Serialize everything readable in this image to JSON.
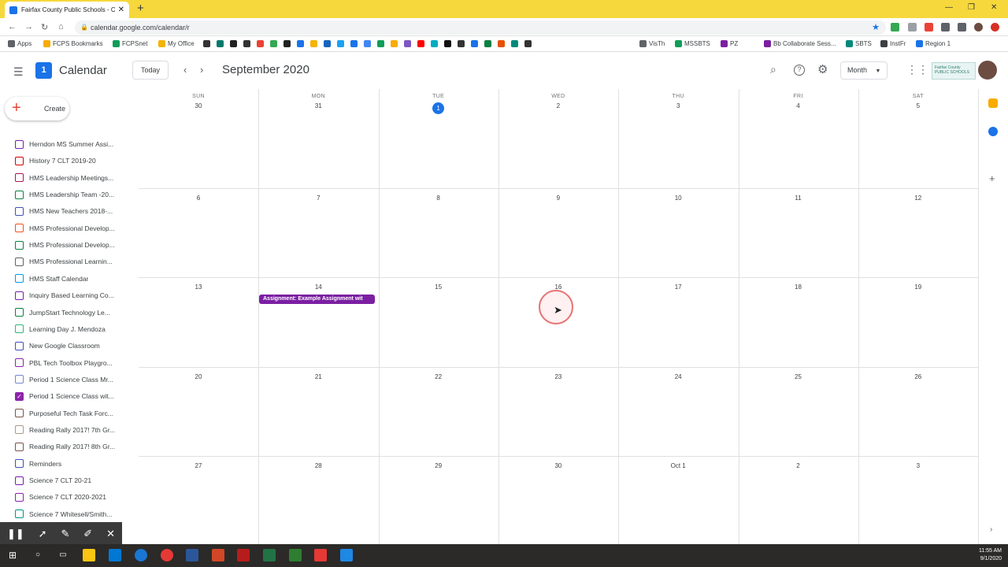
{
  "browser": {
    "tab_title": "Fairfax County Public Schools - C",
    "url": "calendar.google.com/calendar/r"
  },
  "bookmarks": [
    {
      "label": "Apps",
      "color": "#5f6368"
    },
    {
      "label": "FCPS Bookmarks",
      "color": "#f9ab00"
    },
    {
      "label": "FCPSnet",
      "color": "#0f9d58"
    },
    {
      "label": "My Office",
      "color": "#f4b400"
    },
    {
      "label": "VisTh",
      "color": "#5f6368"
    },
    {
      "label": "MSSBTS",
      "color": "#0f9d58"
    },
    {
      "label": "PZ",
      "color": "#7b1fa2"
    },
    {
      "label": "Bb Collaborate Sess...",
      "color": "#7b1fa2"
    },
    {
      "label": "SBTS",
      "color": "#00897b"
    },
    {
      "label": "InstFr",
      "color": "#3c4043"
    },
    {
      "label": "Region 1",
      "color": "#1a73e8"
    }
  ],
  "header": {
    "app_name": "Calendar",
    "logo_day": "1",
    "today_label": "Today",
    "prev_symbol": "‹",
    "next_symbol": "›",
    "month_title": "September 2020",
    "view_label": "Month",
    "org_logo_text": "Fairfax County PUBLIC SCHOOLS"
  },
  "sidebar": {
    "create_label": "Create",
    "calendars": [
      {
        "label": "Herndon MS Summer Assi...",
        "color": "#7b1fa2",
        "checked": false
      },
      {
        "label": "History 7 CLT 2019-20",
        "color": "#d50000",
        "checked": false
      },
      {
        "label": "HMS Leadership Meetings...",
        "color": "#ad1457",
        "checked": false
      },
      {
        "label": "HMS Leadership Team -20...",
        "color": "#0b8043",
        "checked": false
      },
      {
        "label": "HMS New Teachers 2018-...",
        "color": "#3f51b5",
        "checked": false
      },
      {
        "label": "HMS Professional Develop...",
        "color": "#f4511e",
        "checked": false
      },
      {
        "label": "HMS Professional Develop...",
        "color": "#0b8043",
        "checked": false
      },
      {
        "label": "HMS Professional Learnin...",
        "color": "#616161",
        "checked": false
      },
      {
        "label": "HMS Staff Calendar",
        "color": "#039be5",
        "checked": false
      },
      {
        "label": "Inquiry Based Learning Co...",
        "color": "#7b1fa2",
        "checked": false
      },
      {
        "label": "JumpStart Technology Le...",
        "color": "#0b8043",
        "checked": false
      },
      {
        "label": "Learning Day J. Mendoza",
        "color": "#33b679",
        "checked": false
      },
      {
        "label": "New Google Classroom",
        "color": "#3f51b5",
        "checked": false
      },
      {
        "label": "PBL Tech Toolbox Playgro...",
        "color": "#8e24aa",
        "checked": false
      },
      {
        "label": "Period 1 Science Class Mr...",
        "color": "#7986cb",
        "checked": false
      },
      {
        "label": "Period 1 Science Class wit...",
        "color": "#8e24aa",
        "checked": true
      },
      {
        "label": "Purposeful Tech Task Forc...",
        "color": "#795548",
        "checked": false
      },
      {
        "label": "Reading Rally 2017! 7th Gr...",
        "color": "#a79b8e",
        "checked": false
      },
      {
        "label": "Reading Rally 2017! 8th Gr...",
        "color": "#795548",
        "checked": false
      },
      {
        "label": "Reminders",
        "color": "#3f51b5",
        "checked": false
      },
      {
        "label": "Science 7 CLT 20-21",
        "color": "#7b1fa2",
        "checked": false
      },
      {
        "label": "Science 7 CLT 2020-2021",
        "color": "#8e24aa",
        "checked": false
      },
      {
        "label": "Science 7 Whitesell/Smith...",
        "color": "#009688",
        "checked": false
      }
    ]
  },
  "calendar": {
    "weekdays": [
      "SUN",
      "MON",
      "TUE",
      "WED",
      "THU",
      "FRI",
      "SAT"
    ],
    "weeks": [
      [
        "30",
        "31",
        "1",
        "2",
        "3",
        "4",
        "5"
      ],
      [
        "6",
        "7",
        "8",
        "9",
        "10",
        "11",
        "12"
      ],
      [
        "13",
        "14",
        "15",
        "16",
        "17",
        "18",
        "19"
      ],
      [
        "20",
        "21",
        "22",
        "23",
        "24",
        "25",
        "26"
      ],
      [
        "27",
        "28",
        "29",
        "30",
        "Oct 1",
        "2",
        "3"
      ]
    ],
    "today": "1",
    "event": {
      "title": "Assignment: Example Assignment wit",
      "color": "#7b1fa2"
    }
  },
  "taskbar": {
    "time": "11:55 AM",
    "date": "9/1/2020"
  }
}
